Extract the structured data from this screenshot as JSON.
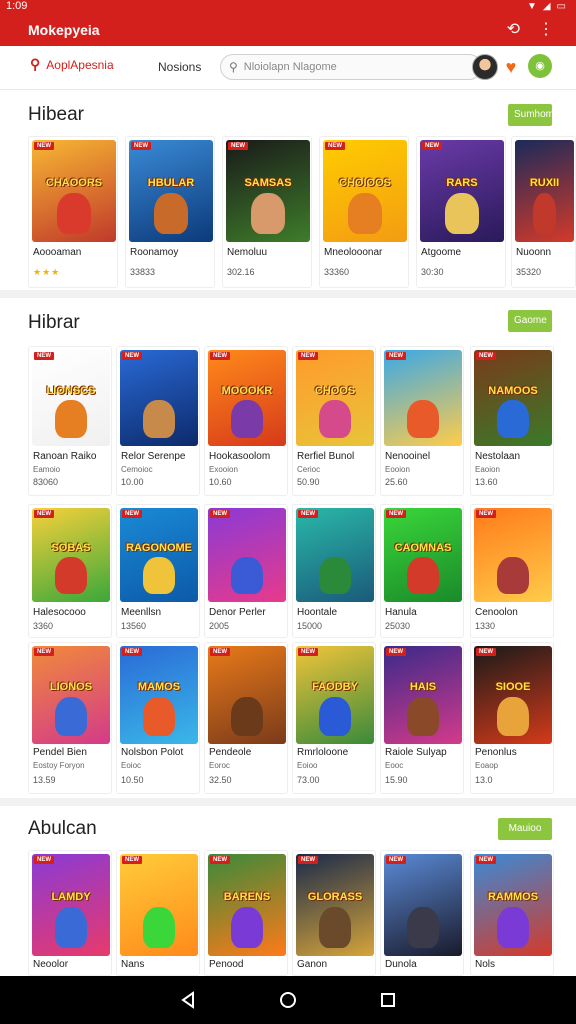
{
  "status_bar": {
    "time": "1:09"
  },
  "app_bar": {
    "title": "Mokepyeia"
  },
  "top_nav": {
    "active_tab": "AoplApesnia",
    "second_tab": "Nosions",
    "search_placeholder": "Nloiolapn Nlagome"
  },
  "colors": {
    "brand_red": "#d4201c",
    "accent_green": "#8cc63f"
  },
  "sections": [
    {
      "title": "Hibear",
      "button": "Sumhome",
      "cards": [
        {
          "name": "Aoooaman",
          "price": "",
          "stars": "★★★",
          "word": "CHAOORS",
          "bg": [
            "#f7b733",
            "#c0392b"
          ],
          "char": "#d93a2b"
        },
        {
          "name": "Roonamoy",
          "price": "33833",
          "word": "HBULAR",
          "bg": [
            "#3a8ad6",
            "#0c3a7a"
          ],
          "char": "#c76a2a"
        },
        {
          "name": "Nemoluu",
          "price": "302.16",
          "word": "SAMSAS",
          "bg": [
            "#1a1a1a",
            "#3e7d2a"
          ],
          "char": "#d89a6a"
        },
        {
          "name": "Mneolooonar",
          "price": "33360",
          "word": "CHOIOOS",
          "bg": [
            "#ffcc00",
            "#f39c12"
          ],
          "char": "#e67e22"
        },
        {
          "name": "Atgoome",
          "price": "30:30",
          "word": "RARS",
          "bg": [
            "#6a3aa8",
            "#2a1a5a"
          ],
          "char": "#e8c45a"
        },
        {
          "name": "Nuoonn",
          "price": "35320",
          "word": "RUXII",
          "bg": [
            "#1a2a5a",
            "#d43a2a"
          ],
          "char": "#c0392b"
        }
      ]
    },
    {
      "title": "Hibrar",
      "button": "Gaome",
      "cards": [
        {
          "name": "Ranoan Raiko",
          "sub": "Eamoio",
          "price": "83060",
          "word": "LIONSCS",
          "bg": [
            "#ffffff",
            "#f0f0f0"
          ],
          "char": "#e67e22"
        },
        {
          "name": "Relor Serenpe",
          "sub": "Cemoioc",
          "price": "10.00",
          "word": "",
          "bg": [
            "#2a6ad6",
            "#0c2a6a"
          ],
          "char": "#c78a4a"
        },
        {
          "name": "Hookasoolom",
          "sub": "Exooion",
          "price": "10.60",
          "word": "MOOOKR",
          "bg": [
            "#ff8a1a",
            "#d63a1a"
          ],
          "char": "#7a3aa8"
        },
        {
          "name": "Rerfiel Bunol",
          "sub": "Cerioc",
          "price": "50.90",
          "word": "CHOOS",
          "bg": [
            "#ff9a2a",
            "#e8c43a"
          ],
          "char": "#d44a8a"
        },
        {
          "name": "Nenooinel",
          "sub": "Eooion",
          "price": "25.60",
          "word": "",
          "bg": [
            "#3aa8e8",
            "#ffcc4a"
          ],
          "char": "#e85a2a"
        },
        {
          "name": "Nestolaan",
          "sub": "Eaoion",
          "price": "13.60",
          "word": "NAMOOS",
          "bg": [
            "#7a3a1a",
            "#3a7a2a"
          ],
          "char": "#2a6ad6"
        }
      ]
    },
    {
      "title": "",
      "button": "",
      "cards": [
        {
          "name": "Halesocooo",
          "price": "3360",
          "word": "SOBAS",
          "bg": [
            "#f7d03a",
            "#3aa83a"
          ],
          "char": "#d43a2a"
        },
        {
          "name": "Meenllsn",
          "price": "13560",
          "word": "RAGONOME",
          "bg": [
            "#1a8ad6",
            "#0c5aa8"
          ],
          "char": "#f0c43a"
        },
        {
          "name": "Denor Perler",
          "price": "2005",
          "word": "",
          "bg": [
            "#8a3ad6",
            "#e83a8a"
          ],
          "char": "#3a5ad6"
        },
        {
          "name": "Hoontale",
          "price": "15000",
          "word": "",
          "bg": [
            "#2ab8a8",
            "#1a5a7a"
          ],
          "char": "#2a8a3a"
        },
        {
          "name": "Hanula",
          "price": "25030",
          "word": "CAOMNAS",
          "bg": [
            "#3ad63a",
            "#1a8a2a"
          ],
          "char": "#d43a2a"
        },
        {
          "name": "Cenoolon",
          "price": "1330",
          "word": "",
          "bg": [
            "#ff7a1a",
            "#ffcc4a"
          ],
          "char": "#a83a3a"
        }
      ]
    },
    {
      "title": "",
      "button": "",
      "cards": [
        {
          "name": "Pendel Bien",
          "sub": "Eostoy Foryon",
          "price": "13.59",
          "word": "LIONOS",
          "bg": [
            "#f08a3a",
            "#d43a8a"
          ],
          "char": "#3a6ad6"
        },
        {
          "name": "Nolsbon Polot",
          "sub": "Eoioc",
          "price": "10.50",
          "word": "MAMOS",
          "bg": [
            "#2a6ad6",
            "#3ab8e8"
          ],
          "char": "#e85a2a"
        },
        {
          "name": "Pendeole",
          "sub": "Eoroc",
          "price": "32.50",
          "word": "",
          "bg": [
            "#e87a1a",
            "#7a3a1a"
          ],
          "char": "#6a3a1a"
        },
        {
          "name": "Rmrloloone",
          "sub": "Eoioo",
          "price": "73.00",
          "word": "FAODBY",
          "bg": [
            "#f0c43a",
            "#3a8a3a"
          ],
          "char": "#2a5ad6"
        },
        {
          "name": "Raiole Sulyap",
          "sub": "Eooc",
          "price": "15.90",
          "word": "HAIS",
          "bg": [
            "#3a2a8a",
            "#d43a8a"
          ],
          "char": "#8a4a2a"
        },
        {
          "name": "Penonlus",
          "sub": "Eoaop",
          "price": "13.0",
          "word": "SIOOE",
          "bg": [
            "#1a1a1a",
            "#d43a1a"
          ],
          "char": "#e8a43a"
        }
      ]
    },
    {
      "title": "Abulcan",
      "button": "Mauioo",
      "cards": [
        {
          "name": "Neoolor",
          "word": "LAMDY",
          "bg": [
            "#8a3ad6",
            "#e83a6a"
          ],
          "char": "#3a6ad6"
        },
        {
          "name": "Nans",
          "word": "",
          "bg": [
            "#ffcc3a",
            "#ff8a1a"
          ],
          "char": "#3ad63a"
        },
        {
          "name": "Penood",
          "word": "BARENS",
          "bg": [
            "#3a8a3a",
            "#ff7a1a"
          ],
          "char": "#7a3ad6"
        },
        {
          "name": "Ganon",
          "word": "GLORASS",
          "bg": [
            "#1a2a4a",
            "#d6a43a"
          ],
          "char": "#6a4a2a"
        },
        {
          "name": "Dunola",
          "word": "",
          "bg": [
            "#5a8ad6",
            "#1a1a2a"
          ],
          "char": "#3a3a4a"
        },
        {
          "name": "Nols",
          "word": "RAMMOS",
          "bg": [
            "#3a8ad6",
            "#d43a2a"
          ],
          "char": "#7a3ad6"
        }
      ]
    }
  ]
}
